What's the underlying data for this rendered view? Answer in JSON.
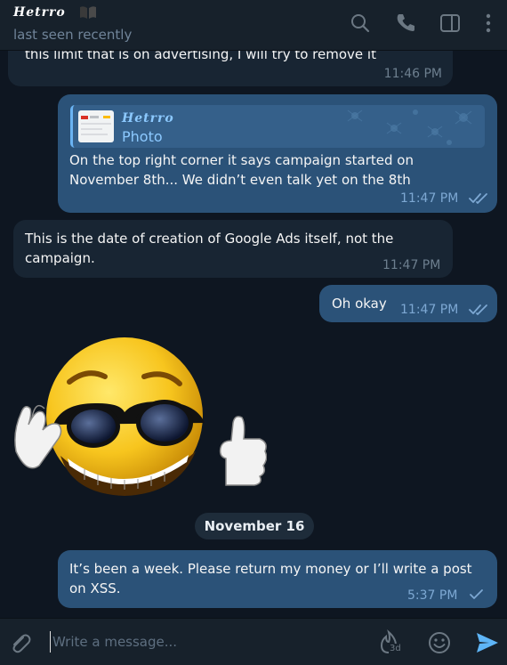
{
  "header": {
    "name": "Hetrro",
    "status": "last seen recently"
  },
  "messages": [
    {
      "text": "this limit that is on advertising, I will try to remove it",
      "time": "11:46 PM"
    },
    {
      "reply_name": "Hetrro",
      "reply_type": "Photo",
      "text": "On the top right corner it says campaign started on November 8th... We didn’t even talk yet on the 8th",
      "time": "11:47 PM"
    },
    {
      "text": "This is the date of creation of Google Ads itself, not the campaign.",
      "time": "11:47 PM"
    },
    {
      "text": "Oh okay",
      "time": "11:47 PM"
    },
    {
      "text": "It’s been a week. Please return my money or I’ll write a post on XSS.",
      "time": "5:37 PM"
    }
  ],
  "date_separator": "November 16",
  "composer": {
    "placeholder": "Write a message...",
    "timer_label": "3d"
  },
  "colors": {
    "background": "#0e1621",
    "incoming": "#182533",
    "outgoing": "#2b5278",
    "accent": "#5eb5f7"
  }
}
